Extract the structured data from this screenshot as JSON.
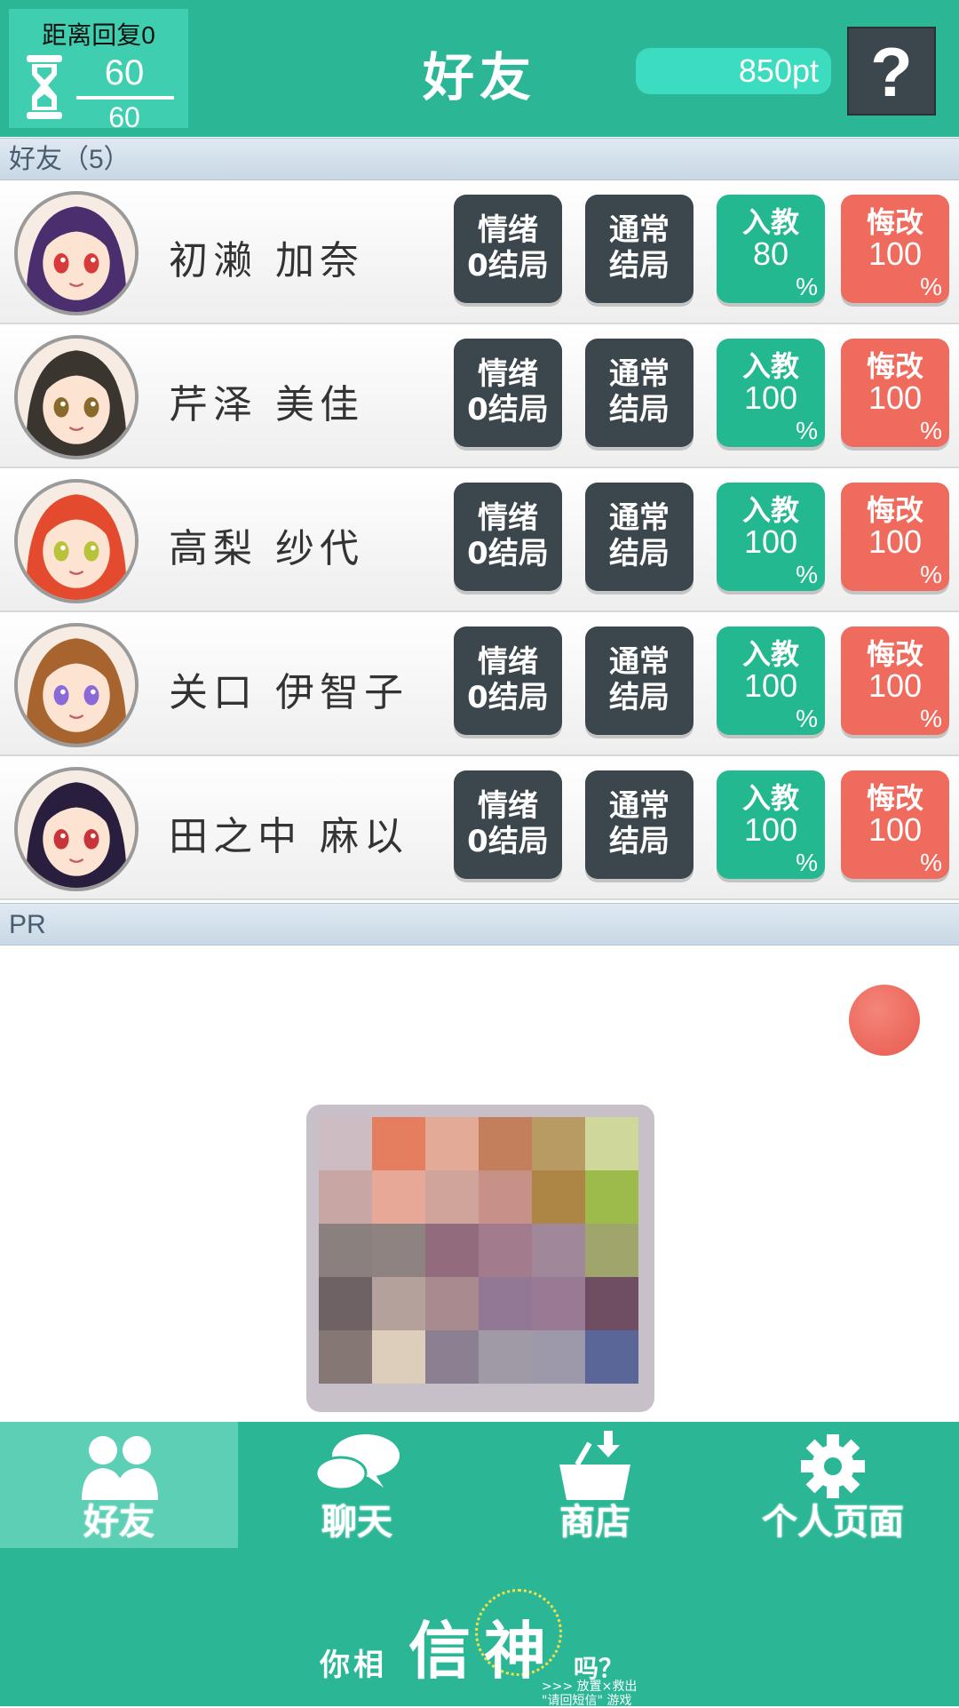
{
  "header": {
    "stamina_label": "距离回复0",
    "stamina_current": "60",
    "stamina_max": "60",
    "title": "好友",
    "points": "850pt",
    "help_label": "?"
  },
  "friends_section": {
    "title": "好友（5）"
  },
  "friends": [
    {
      "name": "初濑 加奈",
      "emotion_line1": "情绪",
      "emotion_line2": "0结局",
      "normal_line1": "通常",
      "normal_line2": "结局",
      "join_label": "入教",
      "join_value": "80",
      "repent_label": "悔改",
      "repent_value": "100",
      "pct": "%"
    },
    {
      "name": "芹泽 美佳",
      "emotion_line1": "情绪",
      "emotion_line2": "0结局",
      "normal_line1": "通常",
      "normal_line2": "结局",
      "join_label": "入教",
      "join_value": "100",
      "repent_label": "悔改",
      "repent_value": "100",
      "pct": "%"
    },
    {
      "name": "高梨 纱代",
      "emotion_line1": "情绪",
      "emotion_line2": "0结局",
      "normal_line1": "通常",
      "normal_line2": "结局",
      "join_label": "入教",
      "join_value": "100",
      "repent_label": "悔改",
      "repent_value": "100",
      "pct": "%"
    },
    {
      "name": "关口 伊智子",
      "emotion_line1": "情绪",
      "emotion_line2": "0结局",
      "normal_line1": "通常",
      "normal_line2": "结局",
      "join_label": "入教",
      "join_value": "100",
      "repent_label": "悔改",
      "repent_value": "100",
      "pct": "%"
    },
    {
      "name": "田之中 麻以",
      "emotion_line1": "情绪",
      "emotion_line2": "0结局",
      "normal_line1": "通常",
      "normal_line2": "结局",
      "join_label": "入教",
      "join_value": "100",
      "repent_label": "悔改",
      "repent_value": "100",
      "pct": "%"
    }
  ],
  "pr_section": {
    "title": "PR"
  },
  "tabs": [
    {
      "label": "好友",
      "icon": "friends-icon",
      "active": true
    },
    {
      "label": "聊天",
      "icon": "chat-icon",
      "active": false
    },
    {
      "label": "商店",
      "icon": "shop-basket-icon",
      "active": false
    },
    {
      "label": "个人页面",
      "icon": "gear-icon",
      "active": false
    }
  ],
  "logo": {
    "left": "你相",
    "big1": "信",
    "big2": "神",
    "right": "吗？",
    "sub1": ">>> 放置×救出",
    "sub2": "\"请回短信\" 游戏"
  },
  "colors": {
    "header_bg": "#2bb796",
    "points_bg": "#3cdcc0",
    "dark_button": "#3c474d",
    "green_button": "#23b890",
    "red_button": "#ef6b5e",
    "section_header": "#d5e2ec"
  },
  "avatar_hair_colors": [
    "#4a2e6e",
    "#3b3530",
    "#e34a2e",
    "#a8642e",
    "#2a1e3e"
  ],
  "avatar_eye_colors": [
    "#d83a3a",
    "#8a6a2a",
    "#b8c33a",
    "#8a6ad6",
    "#c8343a"
  ]
}
